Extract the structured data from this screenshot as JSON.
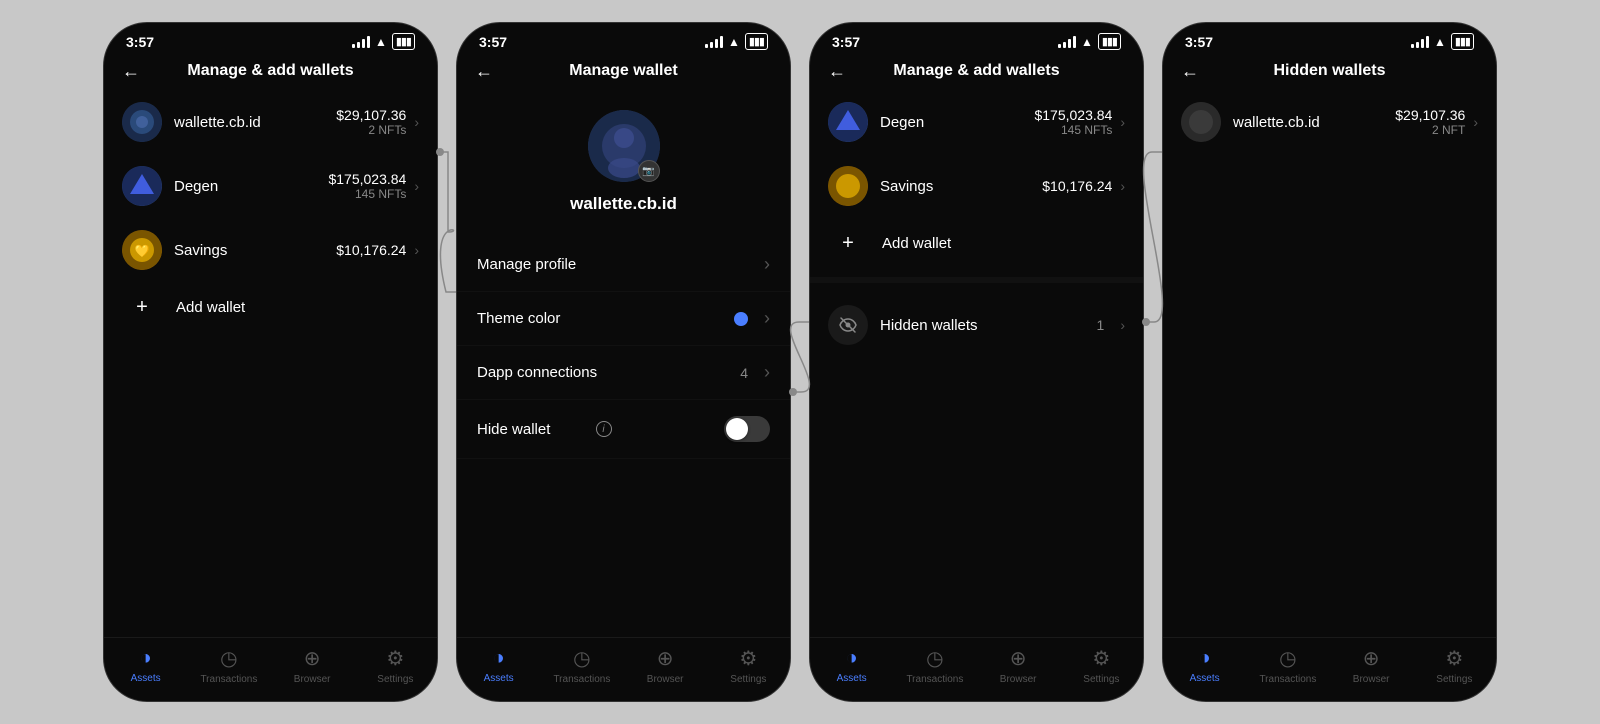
{
  "screens": [
    {
      "id": "screen1",
      "statusTime": "3:57",
      "header": {
        "hasBack": true,
        "title": "Manage & add wallets"
      },
      "wallets": [
        {
          "name": "wallette.cb.id",
          "value": "$29,107.36",
          "sub": "2 NFTs",
          "avatarType": "wallette",
          "avatarEmoji": "🔵"
        },
        {
          "name": "Degen",
          "value": "$175,023.84",
          "sub": "145 NFTs",
          "avatarType": "degen",
          "avatarEmoji": "🔷"
        },
        {
          "name": "Savings",
          "value": "$10,176.24",
          "sub": "",
          "avatarType": "savings",
          "avatarEmoji": "💛"
        }
      ],
      "addWalletLabel": "Add wallet",
      "nav": [
        "Assets",
        "Transactions",
        "Browser",
        "Settings"
      ]
    },
    {
      "id": "screen2",
      "statusTime": "3:57",
      "header": {
        "hasBack": true,
        "title": "Manage wallet"
      },
      "profileName": "wallette.cb.id",
      "menuItems": [
        {
          "label": "Manage profile",
          "type": "chevron",
          "value": ""
        },
        {
          "label": "Theme color",
          "type": "color-dot",
          "value": ""
        },
        {
          "label": "Dapp connections",
          "type": "chevron",
          "value": "4"
        },
        {
          "label": "Hide wallet",
          "type": "toggle",
          "value": ""
        }
      ],
      "nav": [
        "Assets",
        "Transactions",
        "Browser",
        "Settings"
      ]
    },
    {
      "id": "screen3",
      "statusTime": "3:57",
      "header": {
        "hasBack": true,
        "title": "Manage & add wallets"
      },
      "wallets": [
        {
          "name": "Degen",
          "value": "$175,023.84",
          "sub": "145 NFTs",
          "avatarType": "degen",
          "avatarEmoji": "🔷"
        },
        {
          "name": "Savings",
          "value": "$10,176.24",
          "sub": "",
          "avatarType": "savings",
          "avatarEmoji": "💛"
        }
      ],
      "addWalletLabel": "Add wallet",
      "hiddenSection": {
        "label": "Hidden wallets",
        "count": "1"
      },
      "nav": [
        "Assets",
        "Transactions",
        "Browser",
        "Settings"
      ]
    },
    {
      "id": "screen4",
      "statusTime": "3:57",
      "header": {
        "hasBack": true,
        "title": "Hidden wallets"
      },
      "wallets": [
        {
          "name": "wallette.cb.id",
          "value": "$29,107.36",
          "sub": "2 NFT",
          "avatarType": "wallette",
          "avatarEmoji": "🔵"
        }
      ],
      "nav": [
        "Assets",
        "Transactions",
        "Browser",
        "Settings"
      ]
    }
  ],
  "icons": {
    "assets": "◑",
    "transactions": "🕐",
    "browser": "⊕",
    "settings": "⚙",
    "camera": "📷",
    "eyeSlash": "👁"
  }
}
